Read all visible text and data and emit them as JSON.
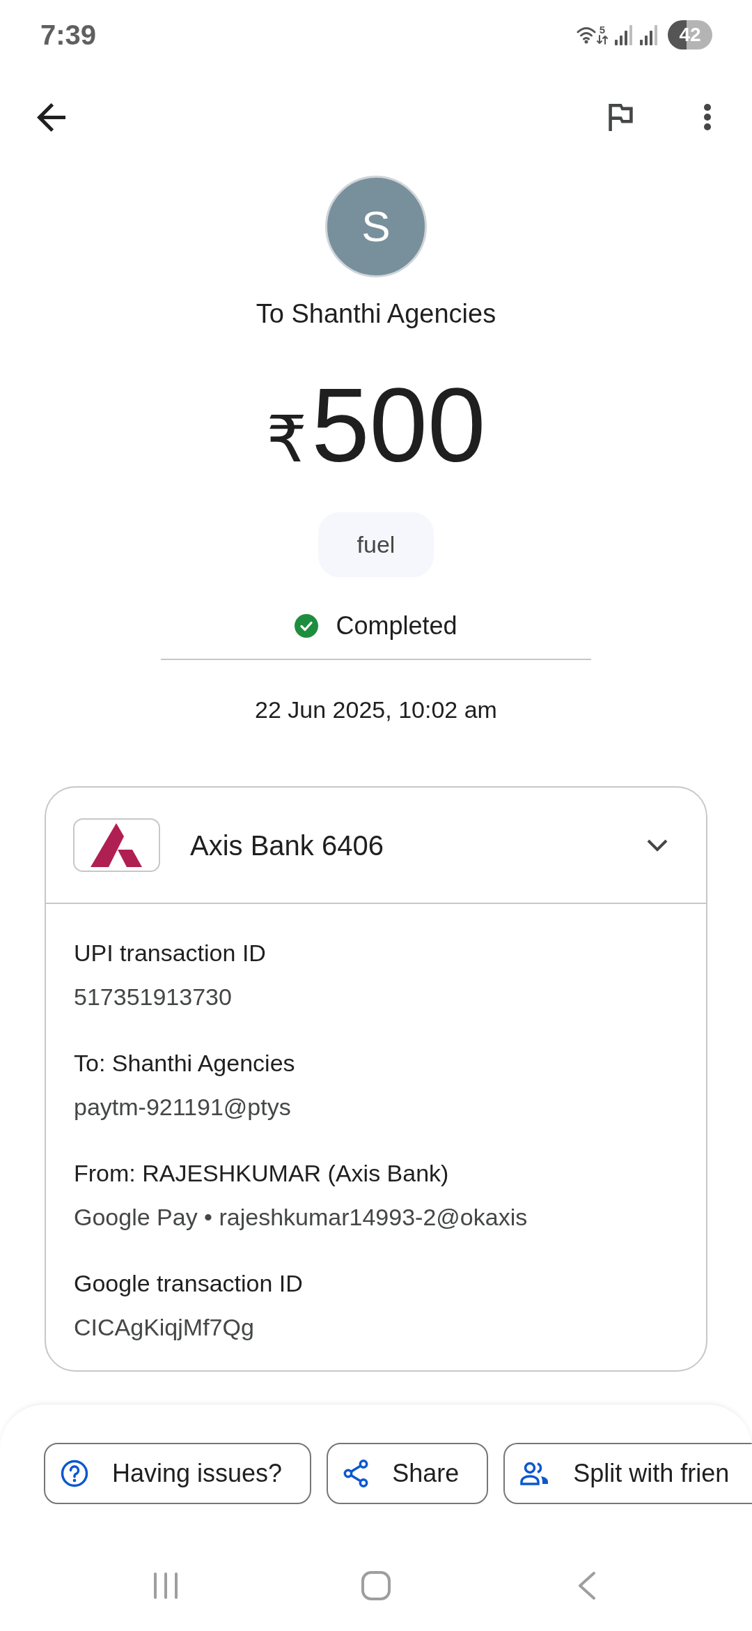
{
  "status_bar": {
    "time": "7:39",
    "wifi_label": "5",
    "battery": "42"
  },
  "payee": {
    "initial": "S",
    "title": "To Shanthi Agencies"
  },
  "amount": {
    "currency": "₹",
    "value": "500"
  },
  "note": "fuel",
  "status": {
    "kind": "completed",
    "label": "Completed"
  },
  "date": "22 Jun 2025, 10:02 am",
  "account_card": {
    "bank": "Axis Bank 6406",
    "expanded": true,
    "details": [
      {
        "label": "UPI transaction ID",
        "value": "517351913730"
      },
      {
        "label": "To: Shanthi Agencies",
        "value": "paytm-921191@ptys"
      },
      {
        "label": "From: RAJESHKUMAR (Axis Bank)",
        "value": "Google Pay • rajeshkumar14993-2@okaxis"
      },
      {
        "label": "Google transaction ID",
        "value": "CICAgKiqjMf7Qg"
      }
    ]
  },
  "actions": [
    {
      "kind": "help",
      "label": "Having issues?"
    },
    {
      "kind": "share",
      "label": "Share"
    },
    {
      "kind": "split",
      "label": "Split with frien"
    }
  ]
}
